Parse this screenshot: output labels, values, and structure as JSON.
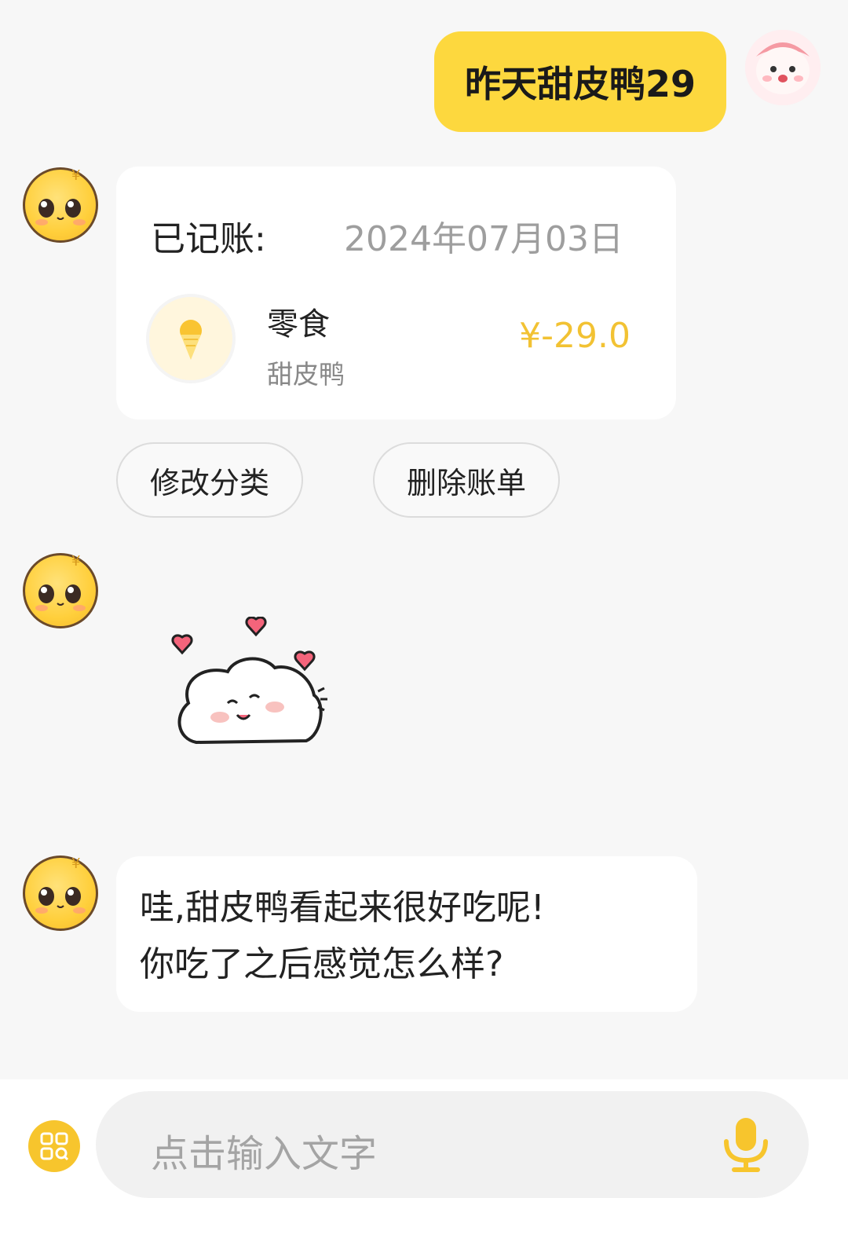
{
  "user_message": {
    "text": "昨天甜皮鸭29"
  },
  "bill_card": {
    "label": "已记账:",
    "date": "2024年07月03日",
    "category": "零食",
    "category_icon": "ice-cream-icon",
    "note": "甜皮鸭",
    "amount": "¥-29.0"
  },
  "actions": {
    "edit_category": "修改分类",
    "delete_bill": "删除账单"
  },
  "sticker": {
    "name": "hearts-bunny-sticker"
  },
  "bot_reply": {
    "line1": "哇,甜皮鸭看起来很好吃呢!",
    "line2": "你吃了之后感觉怎么样?"
  },
  "input": {
    "placeholder": "点击输入文字"
  },
  "colors": {
    "accent_yellow": "#fdd83e",
    "amount_yellow": "#f2c233",
    "background": "#f7f7f7"
  }
}
